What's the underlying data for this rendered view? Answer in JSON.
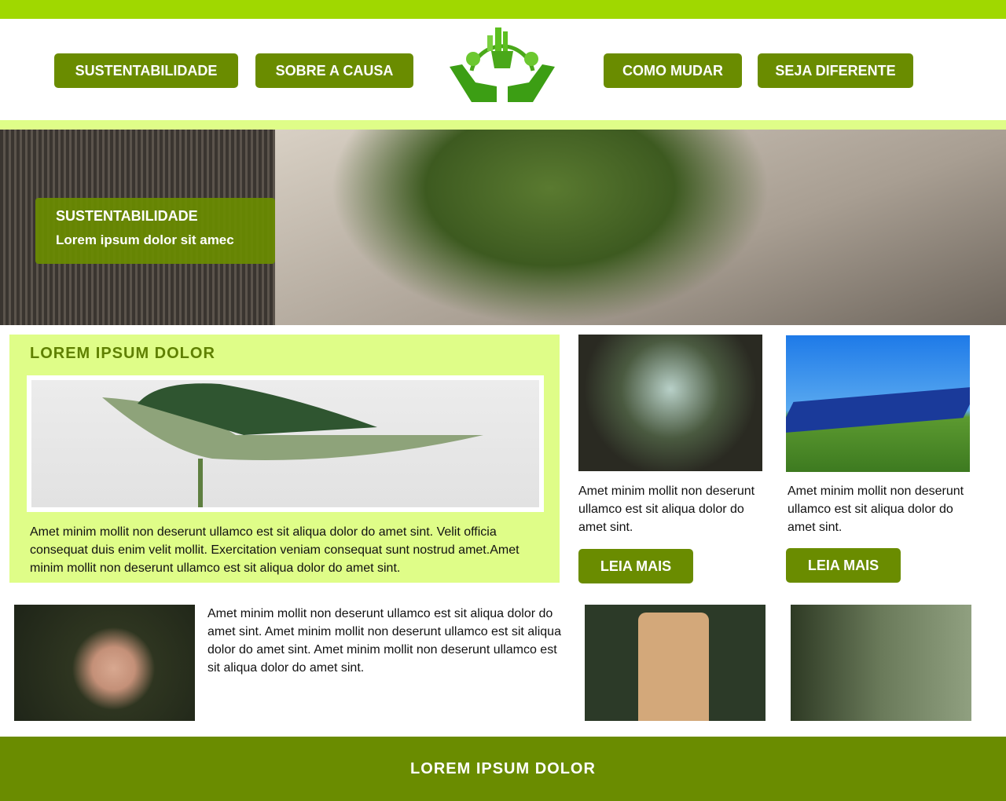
{
  "nav": {
    "left": [
      "SUSTENTABILIDADE",
      "SOBRE A CAUSA"
    ],
    "right": [
      "COMO MUDAR",
      "SEJA DIFERENTE"
    ]
  },
  "hero": {
    "title": "SUSTENTABILIDADE",
    "subtitle": "Lorem ipsum dolor sit amec"
  },
  "feature": {
    "title": "LOREM IPSUM DOLOR",
    "text": "Amet minim mollit non deserunt ullamco est sit aliqua dolor do amet sint. Velit officia consequat duis enim velit mollit. Exercitation veniam consequat sunt nostrud amet.Amet minim mollit non deserunt ullamco est sit aliqua dolor do amet sint."
  },
  "cards": [
    {
      "text": "Amet minim mollit non deserunt ullamco est sit aliqua dolor do amet sint.",
      "button": "LEIA MAIS"
    },
    {
      "text": "Amet minim mollit non deserunt ullamco est sit aliqua dolor do amet sint.",
      "button": "LEIA MAIS"
    }
  ],
  "bottom": {
    "text": "Amet minim mollit non deserunt ullamco est sit aliqua dolor do amet sint. Amet minim mollit non deserunt ullamco est sit aliqua dolor do amet sint. Amet minim mollit non deserunt ullamco est sit aliqua dolor do amet sint."
  },
  "footer": {
    "title": "LOREM IPSUM DOLOR"
  }
}
